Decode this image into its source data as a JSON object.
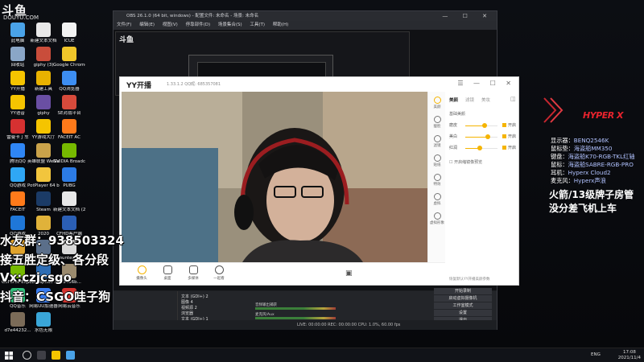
{
  "desktop": {
    "logo": "斗鱼",
    "logo_sub": "DOUYU.COM",
    "icons": [
      {
        "label": "此电脑",
        "color": "#4aa3e8"
      },
      {
        "label": "新建文本文档",
        "color": "#e8e8e8"
      },
      {
        "label": "ICUE",
        "color": "#f2f2f2"
      },
      {
        "label": "回收站",
        "color": "#8aa6c7"
      },
      {
        "label": "giphy (3)",
        "color": "#c94d3b"
      },
      {
        "label": "Google Chrome",
        "color": "#f0c62a"
      },
      {
        "label": "YY开播",
        "color": "#f5c400"
      },
      {
        "label": "新建工具",
        "color": "#e8b200"
      },
      {
        "label": "QQ浏览器",
        "color": "#3d8ef2"
      },
      {
        "label": "YY语音",
        "color": "#f5c400"
      },
      {
        "label": "giphy",
        "color": "#6a4fa3"
      },
      {
        "label": "SE对战平台",
        "color": "#d64a3b"
      },
      {
        "label": "雷曼卡丁车",
        "color": "#d63131"
      },
      {
        "label": "YY游戏大厅",
        "color": "#f5c400"
      },
      {
        "label": "FACEIT AC",
        "color": "#ff7a1a"
      },
      {
        "label": "腾讯QQ",
        "color": "#2f86f5"
      },
      {
        "label": "英雄联盟 WeGame",
        "color": "#c9a24a"
      },
      {
        "label": "NVIDIA Broadcast",
        "color": "#76b900"
      },
      {
        "label": "QQ游戏",
        "color": "#2fa7f5"
      },
      {
        "label": "PotPlayer 64 bit",
        "color": "#f2c53d"
      },
      {
        "label": "PUBG",
        "color": "#2c7be5"
      },
      {
        "label": "FACEIT",
        "color": "#ff7a1a"
      },
      {
        "label": "Steam",
        "color": "#1b3b66"
      },
      {
        "label": "新建文本文档 (2)",
        "color": "#e8e8e8"
      },
      {
        "label": "QQ游戏",
        "color": "#1f77d8"
      },
      {
        "label": "2020",
        "color": "#e0b23a"
      },
      {
        "label": "CFHD客户端",
        "color": "#2b5fb5"
      },
      {
        "label": "PUBG BATTLEGR...",
        "color": "#e0a32c"
      },
      {
        "label": "1570a13cd...",
        "color": "#5b6f8a"
      },
      {
        "label": "Counter-S...",
        "color": "#d9d9d9"
      },
      {
        "label": "GeForce Experience",
        "color": "#76b900"
      },
      {
        "label": "TeamSpeak 3 Client",
        "color": "#2e6db4"
      },
      {
        "label": "813456b...",
        "color": "#9a8a6e"
      },
      {
        "label": "QQ音乐",
        "color": "#31c27c"
      },
      {
        "label": "网易UU加速器",
        "color": "#3a7df0"
      },
      {
        "label": "网易云音乐",
        "color": "#d3332e"
      },
      {
        "label": "d7e44232...",
        "color": "#7b6b58"
      },
      {
        "label": "水色无限",
        "color": "#3aa6d8"
      }
    ]
  },
  "obs": {
    "title": "OBS 26.1.0 (64 bit, windows) - 配置文件: 未命名 - 场景: 未命名",
    "menu": [
      "文件(F)",
      "编辑(E)",
      "视图(V)",
      "停靠部件(D)",
      "场景集合(S)",
      "工具(T)",
      "帮助(H)"
    ],
    "sources": [
      "文本 (GDI+) 2",
      "图像 4",
      "视频源 2",
      "浏览器",
      "文本 (GDI+) 1"
    ],
    "mixer": [
      "音频输出捕获",
      "麦克风/Aux",
      "桌面音频"
    ],
    "controls": [
      "开始录制",
      "启动虚拟摄像机",
      "工作室模式",
      "设置",
      "退出"
    ],
    "status": "LIVE: 00:00:00   REC: 00:00:00   CPU: 1.0%, 60.00 fps",
    "scene_label": "场景 1 (默认场景)"
  },
  "yy": {
    "brand": "YY开播",
    "version": "1.33.1.2   QQ昵: 685357081",
    "window_controls": "☰ — ☐ ✕",
    "tabs": [
      "美颜",
      "滤镜",
      "美妆"
    ],
    "sidebar": [
      "美颜",
      "瘦脸",
      "滤镜",
      "贴纸",
      "特效",
      "虚拟",
      "虚拟形象"
    ],
    "panel_title": "基础美颜",
    "sliders": [
      {
        "label": "磨皮",
        "value": 0.6,
        "toggle": "开启"
      },
      {
        "label": "美白",
        "value": 0.7,
        "toggle": "开启"
      },
      {
        "label": "红润",
        "value": 0.45,
        "toggle": "开启"
      }
    ],
    "option": "开启缩镜像预览",
    "reset": "恢复默认YY开播美颜参数",
    "bottom": [
      "摄像头",
      "桌面",
      "多媒体",
      "一起看"
    ]
  },
  "overlay": {
    "lines": [
      "水友群：938503324",
      "接五胜定级、各分段",
      "Vx:czjcsgo",
      "抖音：CSGO哇子狗"
    ],
    "hyperx": "HYPER X",
    "specs": [
      {
        "k": "显示器：",
        "v": "BENQ2546K"
      },
      {
        "k": "鼠标垫：",
        "v": "海盗船MM350"
      },
      {
        "k": "键盘：",
        "v": "海盗船K70-RGB-TKL红轴"
      },
      {
        "k": "鼠标：",
        "v": "海盗船SABRE-RGB-PRO"
      },
      {
        "k": "耳机：",
        "v": "Hyperx Cloud2"
      },
      {
        "k": "麦克风：",
        "v": "Hyperx声浪"
      }
    ],
    "rocket": [
      "火箭/13级牌子房管",
      "没分差飞机上车"
    ]
  },
  "taskbar": {
    "time": "17:08",
    "date": "2021/11/4",
    "lang": "ENG"
  }
}
